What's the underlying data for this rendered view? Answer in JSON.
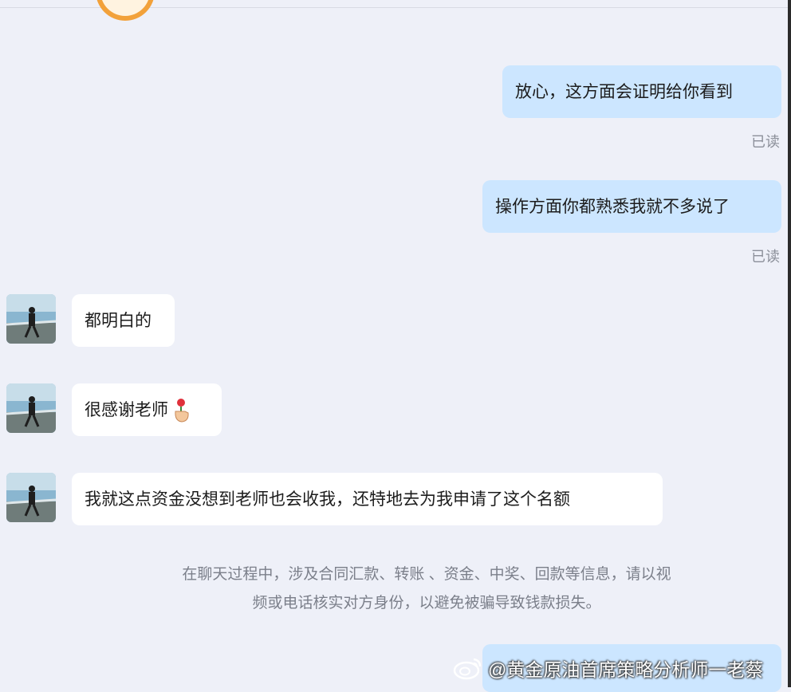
{
  "messages": [
    {
      "text": "放心，这方面会证明给你看到",
      "status": "已读"
    },
    {
      "text": "操作方面你都熟悉我就不多说了",
      "status": "已读"
    },
    {
      "text": "都明白的"
    },
    {
      "text": "很感谢老师"
    },
    {
      "text": "我就这点资金没想到老师也会收我，还特地去为我申请了这个名额"
    }
  ],
  "notice": {
    "line1": "在聊天过程中，涉及合同汇款、转账 、资金、中奖、回款等信息，请以视",
    "line2": "频或电话核实对方身份，以避免被骗导致钱款损失。"
  },
  "watermark": {
    "text": "@黄金原油首席策略分析师一老蔡",
    "icon": "weibo-icon"
  },
  "colors": {
    "background": "#eef0f8",
    "outgoing_bubble": "#cce6ff",
    "incoming_bubble": "#ffffff"
  }
}
